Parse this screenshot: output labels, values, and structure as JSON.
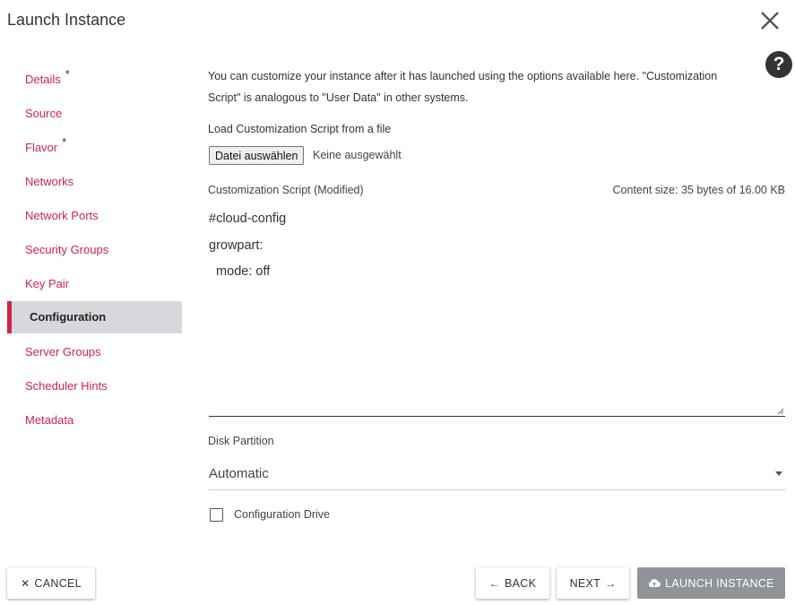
{
  "dialog": {
    "title": "Launch Instance"
  },
  "nav": {
    "items": [
      {
        "label": "Details",
        "required": "*"
      },
      {
        "label": "Source",
        "required": ""
      },
      {
        "label": "Flavor",
        "required": "*"
      },
      {
        "label": "Networks",
        "required": ""
      },
      {
        "label": "Network Ports",
        "required": ""
      },
      {
        "label": "Security Groups",
        "required": ""
      },
      {
        "label": "Key Pair",
        "required": ""
      },
      {
        "label": "Configuration",
        "required": ""
      },
      {
        "label": "Server Groups",
        "required": ""
      },
      {
        "label": "Scheduler Hints",
        "required": ""
      },
      {
        "label": "Metadata",
        "required": ""
      }
    ],
    "active": "Configuration",
    "accent_color": "#d0234d"
  },
  "main": {
    "intro": "You can customize your instance after it has launched using the options available here. \"Customization Script\" is analogous to \"User Data\" in other systems.",
    "load_label": "Load Customization Script from a file",
    "file_button": "Datei auswählen",
    "file_status": "Keine ausgewählt",
    "script_label": "Customization Script (Modified)",
    "content_size": "Content size: 35 bytes of 16.00 KB",
    "script_lines": [
      "#cloud-config",
      "growpart:",
      "  mode: off"
    ],
    "disk_partition_label": "Disk Partition",
    "disk_partition_value": "Automatic",
    "config_drive_label": "Configuration Drive",
    "config_drive_checked": false
  },
  "footer": {
    "cancel_label": "CANCEL",
    "back_label": "BACK",
    "next_label": "NEXT",
    "launch_label": "LAUNCH INSTANCE"
  },
  "icons": {
    "close": "close-icon",
    "help": "question-icon",
    "cancel": "x-icon",
    "back": "arrow-left-icon",
    "next": "arrow-right-icon",
    "launch": "cloud-upload-icon"
  }
}
